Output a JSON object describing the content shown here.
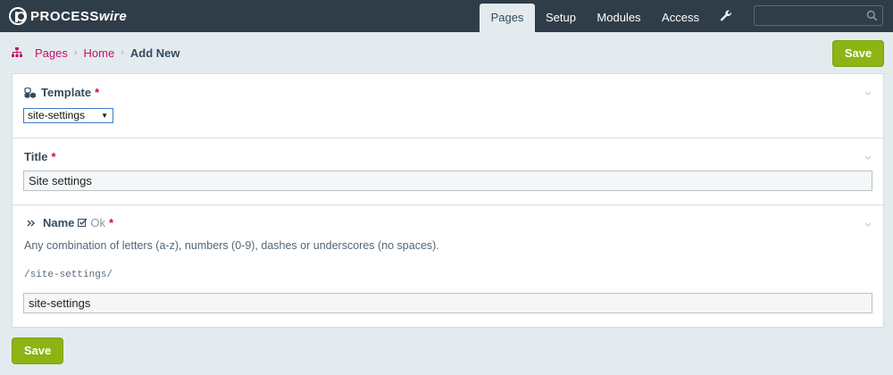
{
  "brand": {
    "part1": "PROCESS",
    "part2": "wire"
  },
  "nav": {
    "items": [
      {
        "label": "Pages",
        "active": true
      },
      {
        "label": "Setup",
        "active": false
      },
      {
        "label": "Modules",
        "active": false
      },
      {
        "label": "Access",
        "active": false
      }
    ],
    "wrench_icon": "wrench-icon",
    "search": {
      "placeholder": "",
      "icon": "search-icon"
    }
  },
  "breadcrumb": {
    "icon": "sitemap-icon",
    "items": [
      "Pages",
      "Home"
    ],
    "current": "Add New",
    "separator": "›"
  },
  "buttons": {
    "save_top": "Save",
    "save_bottom": "Save"
  },
  "form": {
    "template": {
      "label": "Template",
      "required": "*",
      "selected": "site-settings",
      "icon": "cubes-icon"
    },
    "title": {
      "label": "Title",
      "required": "*",
      "value": "Site settings"
    },
    "name": {
      "label": "Name",
      "status": "Ok",
      "required": "*",
      "icon": "angle-double-right-icon",
      "description": "Any combination of letters (a-z), numbers (0-9), dashes or underscores (no spaces).",
      "path": "/site-settings/",
      "value": "site-settings"
    }
  },
  "colors": {
    "topbar": "#2f3d49",
    "accent_link": "#c1126a",
    "button": "#8cb414",
    "background": "#e4ebee"
  }
}
